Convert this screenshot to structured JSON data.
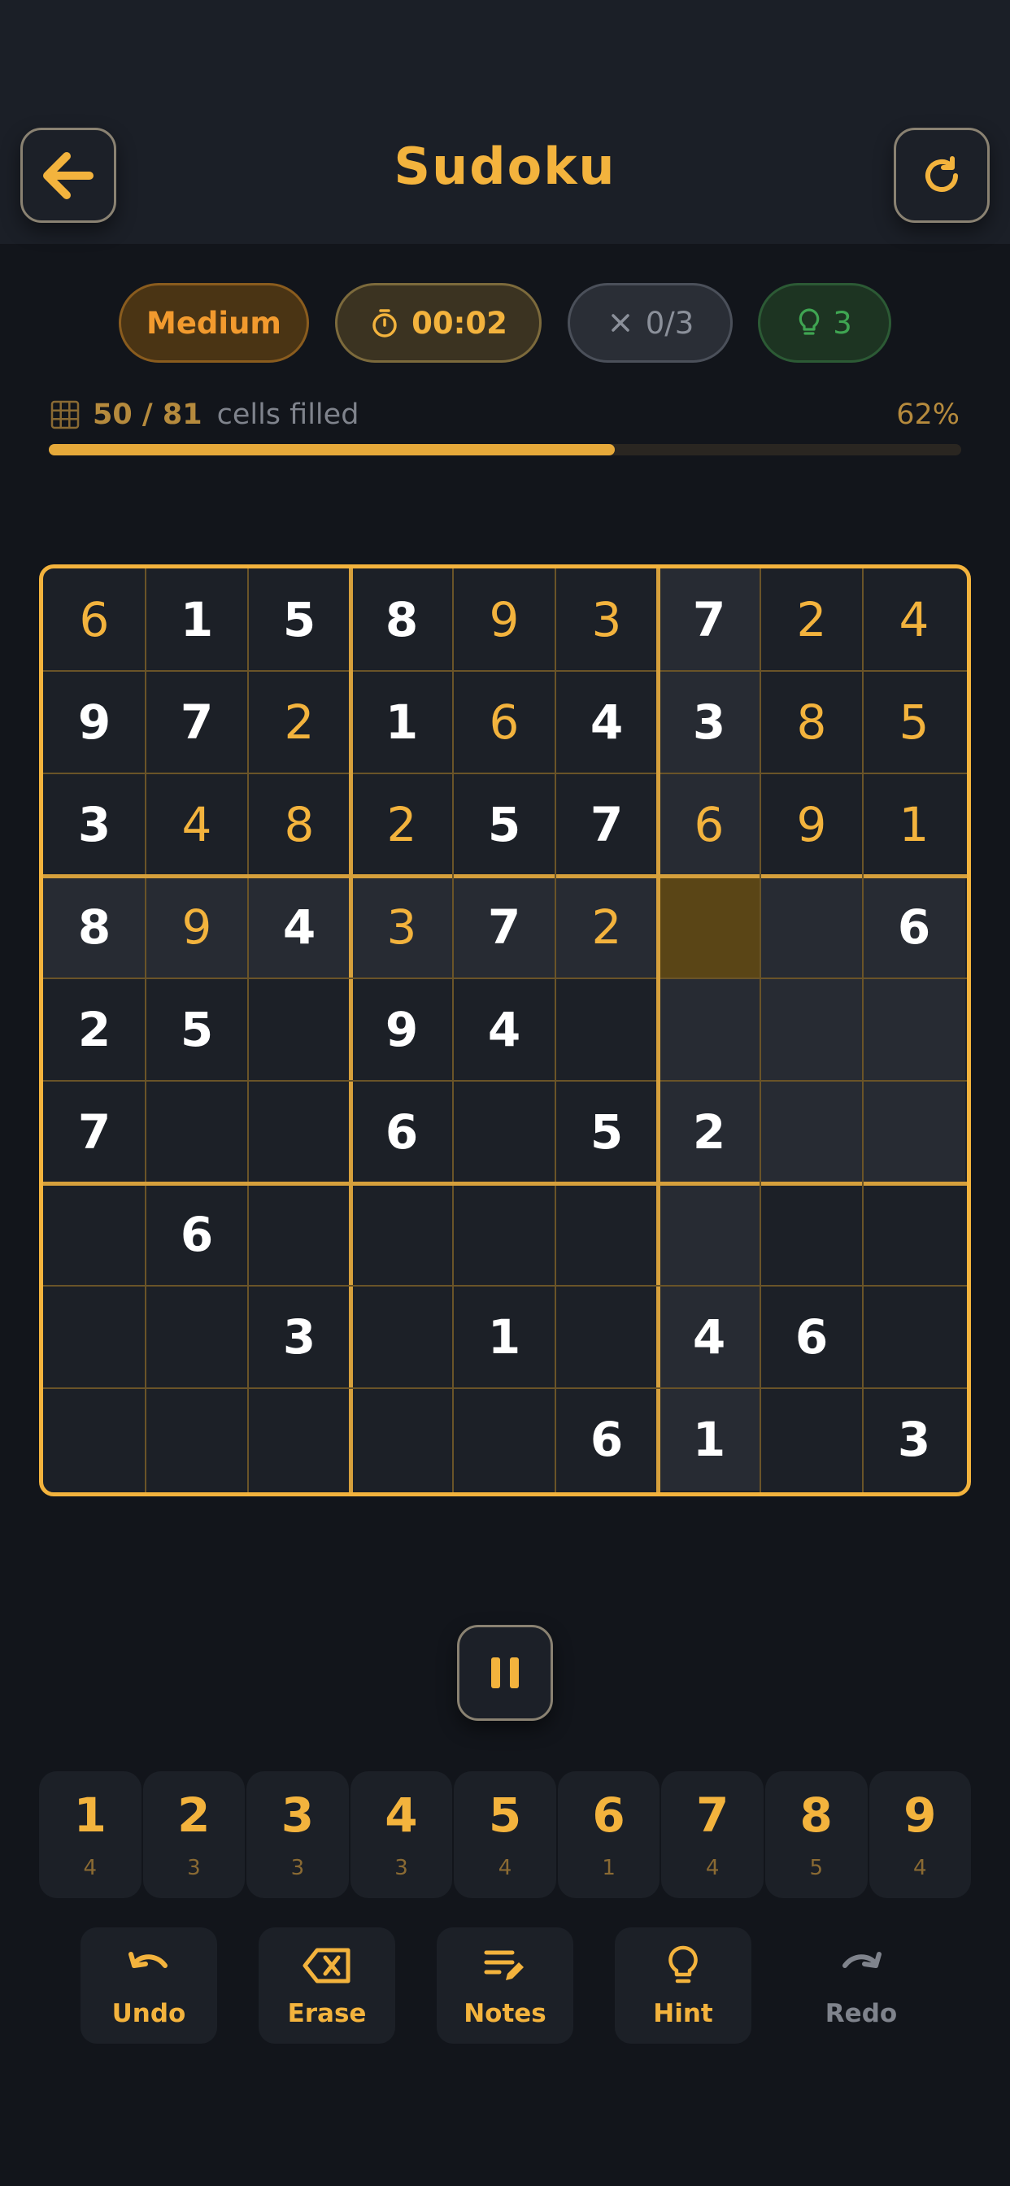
{
  "header": {
    "title": "Sudoku",
    "back_icon": "arrow-left-icon",
    "restart_icon": "refresh-icon"
  },
  "status": {
    "difficulty": "Medium",
    "timer": "00:02",
    "mistakes": "0/3",
    "hints": "3"
  },
  "progress": {
    "filled": "50 / 81",
    "label": "cells filled",
    "percent": "62%",
    "fraction": 0.62
  },
  "board": {
    "rows": [
      [
        "6",
        "1",
        "5",
        "8",
        "9",
        "3",
        "7",
        "2",
        "4"
      ],
      [
        "9",
        "7",
        "2",
        "1",
        "6",
        "4",
        "3",
        "8",
        "5"
      ],
      [
        "3",
        "4",
        "8",
        "2",
        "5",
        "7",
        "6",
        "9",
        "1"
      ],
      [
        "8",
        "9",
        "4",
        "3",
        "7",
        "2",
        "",
        "",
        "6"
      ],
      [
        "2",
        "5",
        "",
        "9",
        "4",
        "",
        "",
        "",
        ""
      ],
      [
        "7",
        "",
        "",
        "6",
        "",
        "5",
        "2",
        "",
        ""
      ],
      [
        "",
        "6",
        "",
        "",
        "",
        "",
        "",
        "",
        ""
      ],
      [
        "",
        "",
        "3",
        "",
        "1",
        "",
        "4",
        "6",
        ""
      ],
      [
        "",
        "",
        "",
        "",
        "",
        "6",
        "1",
        "",
        "3"
      ]
    ],
    "user_entries": [
      [
        0,
        0
      ],
      [
        0,
        4
      ],
      [
        0,
        5
      ],
      [
        0,
        7
      ],
      [
        0,
        8
      ],
      [
        1,
        2
      ],
      [
        1,
        4
      ],
      [
        1,
        7
      ],
      [
        1,
        8
      ],
      [
        2,
        1
      ],
      [
        2,
        2
      ],
      [
        2,
        3
      ],
      [
        2,
        6
      ],
      [
        2,
        7
      ],
      [
        2,
        8
      ],
      [
        3,
        1
      ],
      [
        3,
        3
      ],
      [
        3,
        5
      ]
    ],
    "selected": [
      3,
      6
    ],
    "colors": {
      "accent": "#f3b33d",
      "given": "#ffffff",
      "selected_bg": "#5a4516",
      "highlight_bg": "#272b33"
    }
  },
  "numpad": [
    {
      "digit": "1",
      "count": "4"
    },
    {
      "digit": "2",
      "count": "3"
    },
    {
      "digit": "3",
      "count": "3"
    },
    {
      "digit": "4",
      "count": "3"
    },
    {
      "digit": "5",
      "count": "4"
    },
    {
      "digit": "6",
      "count": "1"
    },
    {
      "digit": "7",
      "count": "4"
    },
    {
      "digit": "8",
      "count": "5"
    },
    {
      "digit": "9",
      "count": "4"
    }
  ],
  "actions": [
    {
      "label": "Undo",
      "icon": "undo-icon"
    },
    {
      "label": "Erase",
      "icon": "backspace-icon"
    },
    {
      "label": "Notes",
      "icon": "pencil-notes-icon"
    },
    {
      "label": "Hint",
      "icon": "lightbulb-icon"
    },
    {
      "label": "Redo",
      "icon": "redo-icon",
      "disabled": true
    }
  ]
}
